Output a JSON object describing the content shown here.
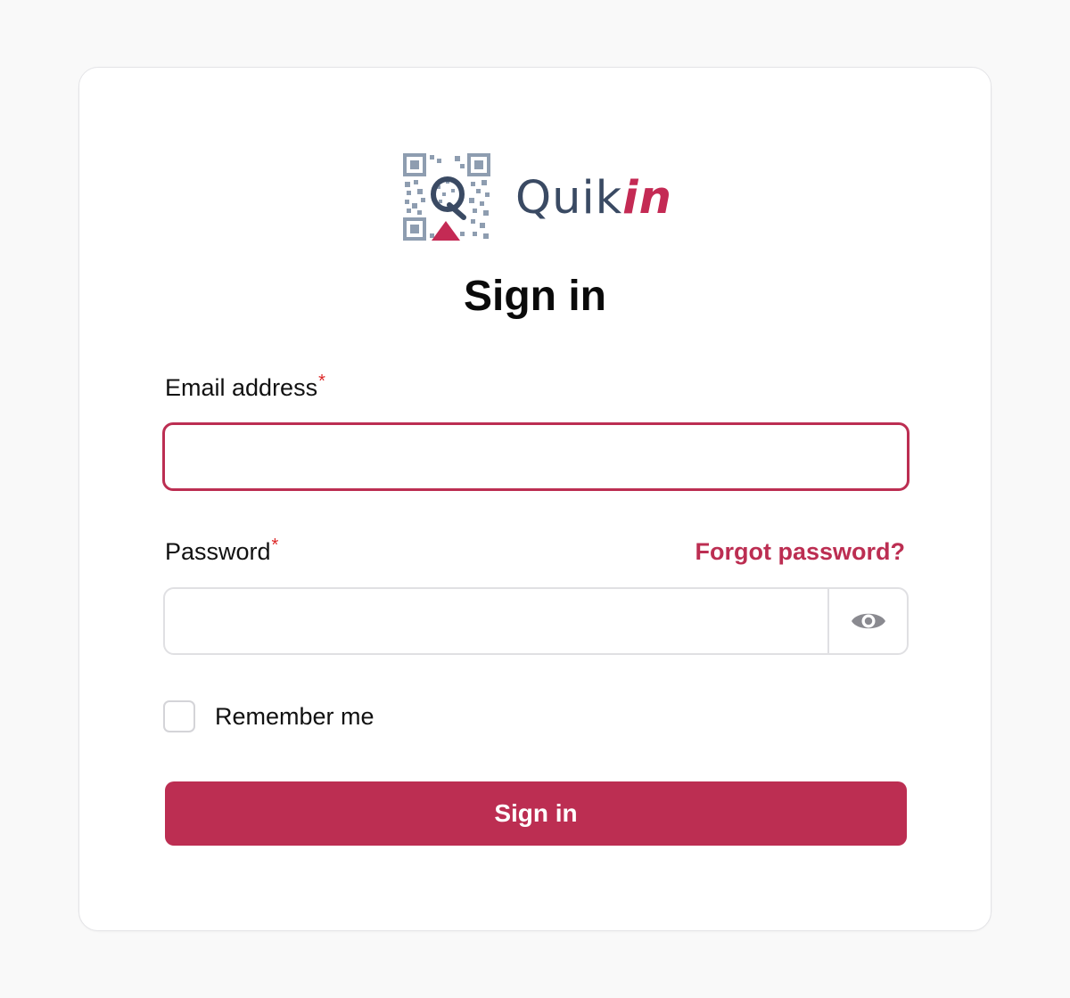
{
  "brand": {
    "name_part1": "Quik",
    "name_part2": "in",
    "logo_icon": "qr-code-logo-icon",
    "primary_color": "#bc2e52",
    "secondary_color": "#3a4a63"
  },
  "page": {
    "title": "Sign in"
  },
  "form": {
    "email": {
      "label": "Email address",
      "required_mark": "*",
      "value": "",
      "placeholder": ""
    },
    "password": {
      "label": "Password",
      "required_mark": "*",
      "value": "",
      "placeholder": "",
      "toggle_icon": "eye-icon"
    },
    "forgot_link": "Forgot password?",
    "remember_me": {
      "label": "Remember me",
      "checked": false
    },
    "submit_label": "Sign in"
  }
}
